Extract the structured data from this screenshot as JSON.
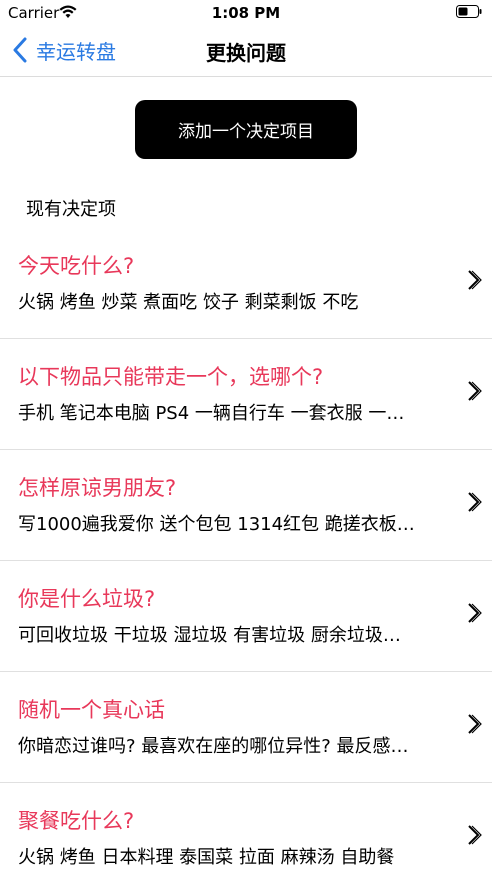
{
  "status_bar": {
    "carrier": "Carrier",
    "time": "1:08 PM"
  },
  "nav": {
    "back_label": "幸运转盘",
    "title": "更换问题"
  },
  "add_button": {
    "label": "添加一个决定项目"
  },
  "section_title": "现有决定项",
  "accent_color": "#e8385a",
  "link_color": "#2a7ae2",
  "decisions": [
    {
      "title": "今天吃什么?",
      "options": "火锅  烤鱼  炒菜  煮面吃  饺子  剩菜剩饭  不吃"
    },
    {
      "title": "以下物品只能带走一个，选哪个?",
      "options": "手机  笔记本电脑  PS4  一辆自行车  一套衣服  一…"
    },
    {
      "title": "怎样原谅男朋友?",
      "options": "写1000遍我爱你  送个包包  1314红包  跪搓衣板…"
    },
    {
      "title": "你是什么垃圾?",
      "options": "可回收垃圾  干垃圾  湿垃圾  有害垃圾  厨余垃圾…"
    },
    {
      "title": "随机一个真心话",
      "options": "你暗恋过谁吗?   最喜欢在座的哪位异性?   最反感…"
    },
    {
      "title": "聚餐吃什么?",
      "options": "火锅  烤鱼  日本料理  泰国菜  拉面  麻辣汤  自助餐"
    }
  ]
}
